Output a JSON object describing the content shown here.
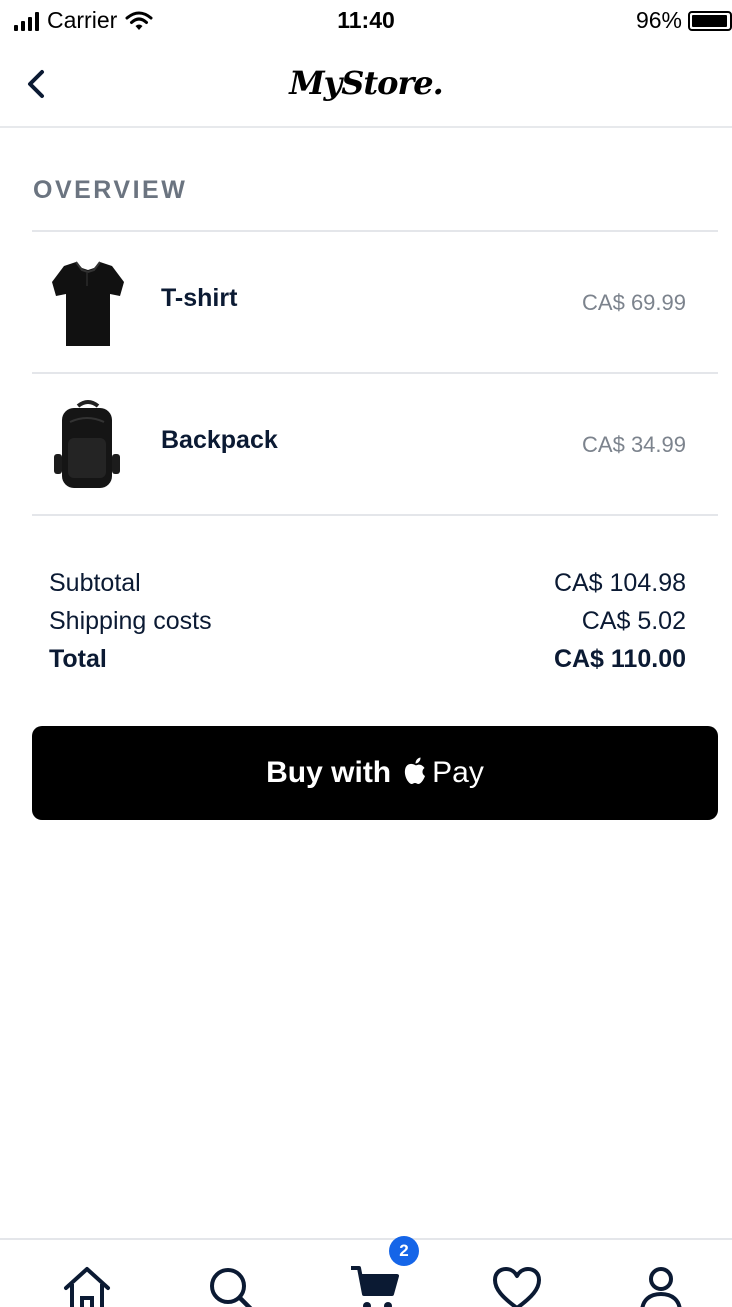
{
  "status_bar": {
    "carrier": "Carrier",
    "time": "11:40",
    "battery_percent": "96%",
    "battery_level": 0.96,
    "signal_icon": "signal-bars-icon",
    "wifi_icon": "wifi-icon"
  },
  "nav": {
    "back_icon": "chevron-left-icon",
    "logo_text": "MyStore."
  },
  "overview": {
    "title": "OVERVIEW",
    "items": [
      {
        "name": "T-shirt",
        "price": "CA$ 69.99",
        "thumbnail": "tshirt-image"
      },
      {
        "name": "Backpack",
        "price": "CA$ 34.99",
        "thumbnail": "backpack-image"
      }
    ]
  },
  "summary": {
    "subtotal_label": "Subtotal",
    "subtotal_value": "CA$ 104.98",
    "shipping_label": "Shipping costs",
    "shipping_value": "CA$ 5.02",
    "total_label": "Total",
    "total_value": "CA$ 110.00"
  },
  "apple_pay": {
    "prefix": "Buy with",
    "suffix": "Pay",
    "icon": "apple-logo-icon"
  },
  "tab_bar": {
    "tabs": [
      {
        "icon": "home-icon"
      },
      {
        "icon": "search-icon"
      },
      {
        "icon": "cart-icon"
      },
      {
        "icon": "heart-icon"
      },
      {
        "icon": "profile-icon"
      }
    ],
    "cart_badge": "2"
  },
  "colors": {
    "text_dark": "#0b1a33",
    "text_muted": "#7c838d",
    "section_title": "#6b7480",
    "divider": "#e4e6ea",
    "button_bg": "#000000",
    "badge_bg": "#1565e8"
  }
}
